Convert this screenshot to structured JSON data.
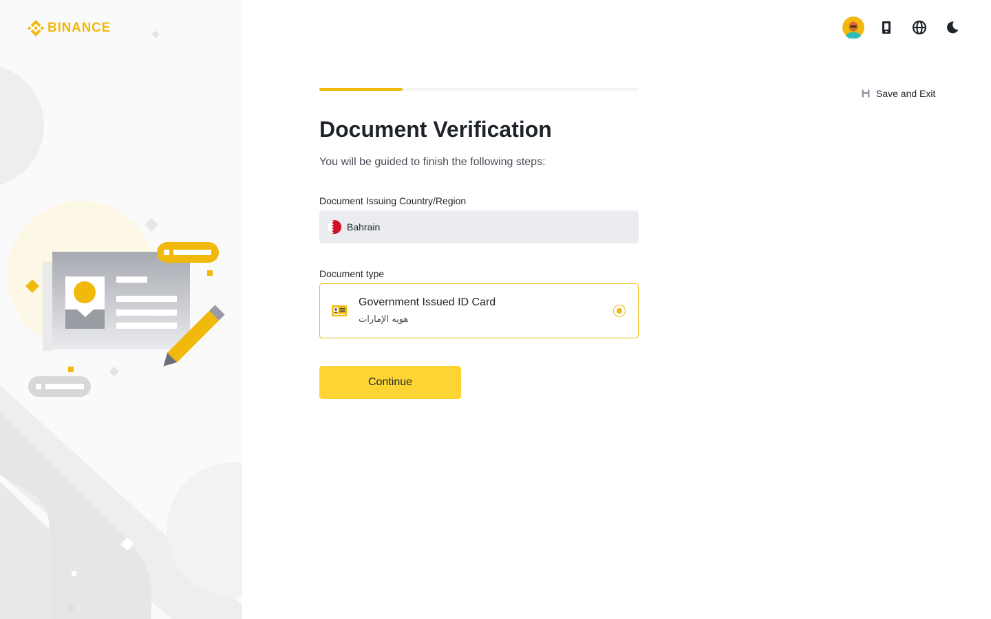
{
  "brand": {
    "name": "BINANCE",
    "color": "#f0b90b"
  },
  "header": {
    "icons": [
      "avatar",
      "mobile-download-icon",
      "globe-icon",
      "moon-icon"
    ]
  },
  "save_exit": {
    "label": "Save and Exit",
    "icon": "save-icon"
  },
  "progress": {
    "fraction": 0.26
  },
  "form": {
    "title": "Document Verification",
    "subtitle": "You will be guided to finish the following steps:",
    "country_label": "Document Issuing Country/Region",
    "country_value": "Bahrain",
    "doctype_label": "Document type",
    "doc_option": {
      "title": "Government Issued ID Card",
      "subtitle": "هويه الإمارات",
      "selected": true
    },
    "continue_label": "Continue"
  },
  "colors": {
    "accent": "#f0b90b",
    "button": "#fcd535",
    "field_bg": "#eaecef",
    "text": "#1e2329",
    "muted": "#474d57"
  }
}
